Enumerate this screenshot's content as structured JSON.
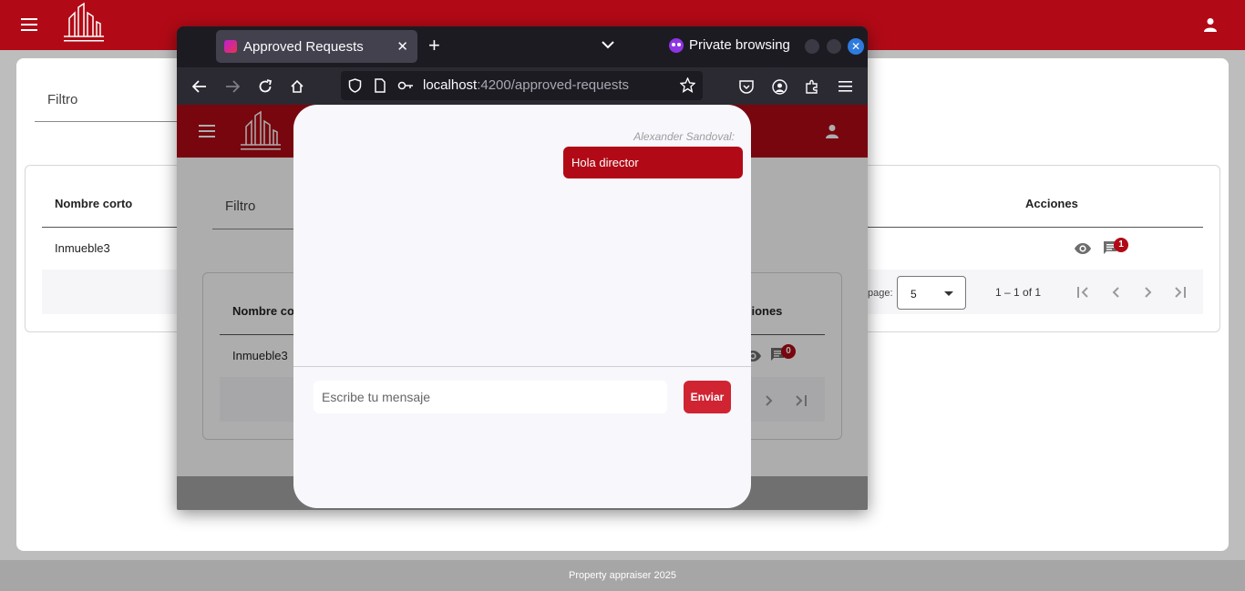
{
  "app": {
    "footer_text": "Property appraiser 2025",
    "filter_label": "Filtro",
    "table": {
      "columns": [
        "Nombre corto",
        "Acciones"
      ],
      "rows": [
        {
          "name": "Inmueble3",
          "comment_count": "1"
        }
      ]
    },
    "paginator": {
      "per_page_label": "page:",
      "per_page_value": "5",
      "range": "1 – 1 of 1"
    },
    "colors": {
      "header": "#b10a16",
      "footer": "#a6a6a6",
      "accent": "#d02433"
    }
  },
  "browser": {
    "tab_title": "Approved Requests",
    "tab_close": "✕",
    "new_tab": "+",
    "private_label": "Private browsing",
    "close_glyph": "✕",
    "url_host": "localhost",
    "url_path": ":4200/approved-requests",
    "inner": {
      "filter_label": "Filtro",
      "column_name": "Nombre cor",
      "column_actions": "cciones",
      "row_name": "Inmueble3",
      "comment_count": "0"
    }
  },
  "chat": {
    "sender": "Alexander Sandoval:",
    "message": "Hola director",
    "input_placeholder": "Escribe tu mensaje",
    "send_label": "Enviar"
  }
}
